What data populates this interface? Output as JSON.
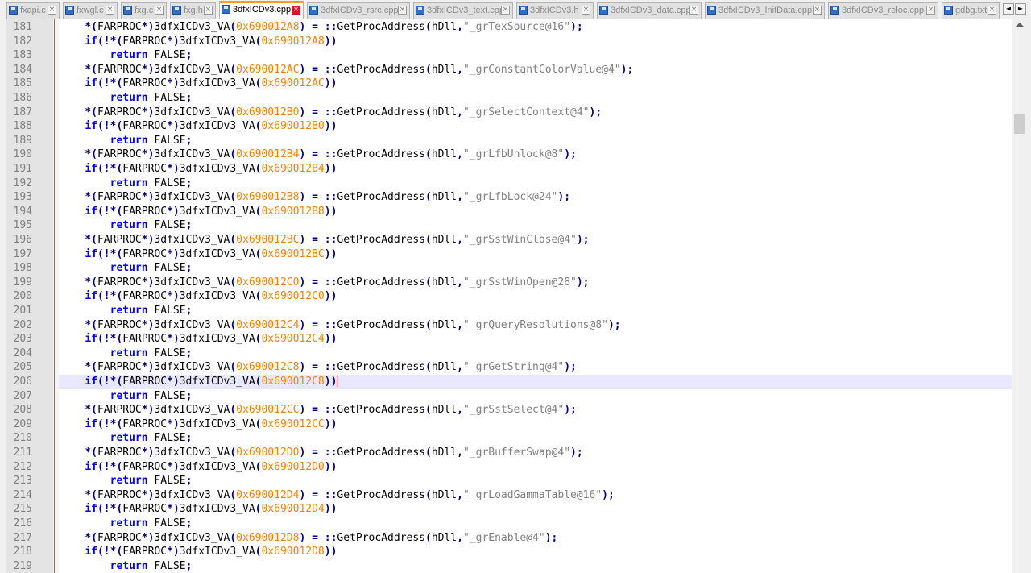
{
  "tabs": [
    {
      "label": "fxapi.c",
      "active": false
    },
    {
      "label": "fxwgl.c",
      "active": false
    },
    {
      "label": "fxg.c",
      "active": false
    },
    {
      "label": "fxg.h",
      "active": false
    },
    {
      "label": "3dfxICDv3.cpp",
      "active": true
    },
    {
      "label": "3dfxICDv3_rsrc.cpp",
      "active": false
    },
    {
      "label": "3dfxICDv3_text.cpp",
      "active": false
    },
    {
      "label": "3dfxICDv3.h",
      "active": false
    },
    {
      "label": "3dfxICDv3_data.cpp",
      "active": false
    },
    {
      "label": "3dfxICDv3_InitData.cpp",
      "active": false
    },
    {
      "label": "3dfxICDv3_reloc.cpp",
      "active": false
    },
    {
      "label": "gdbg.txt",
      "active": false
    }
  ],
  "tab_nav": {
    "left": "◄",
    "right": "►"
  },
  "editor": {
    "current_line": "206",
    "lines": [
      {
        "n": "181",
        "kind": "assign",
        "addr": "0x690012A8",
        "fn": "\"_grTexSource@16\""
      },
      {
        "n": "182",
        "kind": "if",
        "addr": "0x690012A8"
      },
      {
        "n": "183",
        "kind": "ret"
      },
      {
        "n": "184",
        "kind": "assign",
        "addr": "0x690012AC",
        "fn": "\"_grConstantColorValue@4\""
      },
      {
        "n": "185",
        "kind": "if",
        "addr": "0x690012AC"
      },
      {
        "n": "186",
        "kind": "ret"
      },
      {
        "n": "187",
        "kind": "assign",
        "addr": "0x690012B0",
        "fn": "\"_grSelectContext@4\""
      },
      {
        "n": "188",
        "kind": "if",
        "addr": "0x690012B0"
      },
      {
        "n": "189",
        "kind": "ret"
      },
      {
        "n": "190",
        "kind": "assign",
        "addr": "0x690012B4",
        "fn": "\"_grLfbUnlock@8\""
      },
      {
        "n": "191",
        "kind": "if",
        "addr": "0x690012B4"
      },
      {
        "n": "192",
        "kind": "ret"
      },
      {
        "n": "193",
        "kind": "assign",
        "addr": "0x690012B8",
        "fn": "\"_grLfbLock@24\""
      },
      {
        "n": "194",
        "kind": "if",
        "addr": "0x690012B8"
      },
      {
        "n": "195",
        "kind": "ret"
      },
      {
        "n": "196",
        "kind": "assign",
        "addr": "0x690012BC",
        "fn": "\"_grSstWinClose@4\""
      },
      {
        "n": "197",
        "kind": "if",
        "addr": "0x690012BC"
      },
      {
        "n": "198",
        "kind": "ret"
      },
      {
        "n": "199",
        "kind": "assign",
        "addr": "0x690012C0",
        "fn": "\"_grSstWinOpen@28\""
      },
      {
        "n": "200",
        "kind": "if",
        "addr": "0x690012C0"
      },
      {
        "n": "201",
        "kind": "ret"
      },
      {
        "n": "202",
        "kind": "assign",
        "addr": "0x690012C4",
        "fn": "\"_grQueryResolutions@8\""
      },
      {
        "n": "203",
        "kind": "if",
        "addr": "0x690012C4"
      },
      {
        "n": "204",
        "kind": "ret"
      },
      {
        "n": "205",
        "kind": "assign",
        "addr": "0x690012C8",
        "fn": "\"_grGetString@4\""
      },
      {
        "n": "206",
        "kind": "if",
        "addr": "0x690012C8"
      },
      {
        "n": "207",
        "kind": "ret"
      },
      {
        "n": "208",
        "kind": "assign",
        "addr": "0x690012CC",
        "fn": "\"_grSstSelect@4\""
      },
      {
        "n": "209",
        "kind": "if",
        "addr": "0x690012CC"
      },
      {
        "n": "210",
        "kind": "ret"
      },
      {
        "n": "211",
        "kind": "assign",
        "addr": "0x690012D0",
        "fn": "\"_grBufferSwap@4\""
      },
      {
        "n": "212",
        "kind": "if",
        "addr": "0x690012D0"
      },
      {
        "n": "213",
        "kind": "ret"
      },
      {
        "n": "214",
        "kind": "assign",
        "addr": "0x690012D4",
        "fn": "\"_grLoadGammaTable@16\""
      },
      {
        "n": "215",
        "kind": "if",
        "addr": "0x690012D4"
      },
      {
        "n": "216",
        "kind": "ret"
      },
      {
        "n": "217",
        "kind": "assign",
        "addr": "0x690012D8",
        "fn": "\"_grEnable@4\""
      },
      {
        "n": "218",
        "kind": "if",
        "addr": "0x690012D8"
      },
      {
        "n": "219",
        "kind": "ret"
      }
    ]
  },
  "tokens": {
    "indent1": "    ",
    "indent2": "        ",
    "star": "*",
    "cast_open": "(",
    "farproc": "FARPROC",
    "cast_close": "*)",
    "va": "3dfxICDv3_VA",
    "paren_open": "(",
    "paren_close": ")",
    "assign": " = ::",
    "getproc": "GetProcAddress",
    "hdll_open": "(",
    "hdll": "hDll",
    "comma": ",",
    "call_close": ");",
    "if_kw": "if",
    "if_open": "(!",
    "if_close": "))",
    "return_kw": "return",
    "false_val": " FALSE",
    "semicolon": ";"
  },
  "colors": {
    "keyword": "#0000ff",
    "number": "#ff8000",
    "string": "#808080",
    "operator": "#000080",
    "line_number": "#808080",
    "current_line_bg": "#e8e8ff",
    "active_tab_accent": "#fa9a27"
  },
  "icons": {
    "tab": "file-icon",
    "close": "close-icon"
  }
}
